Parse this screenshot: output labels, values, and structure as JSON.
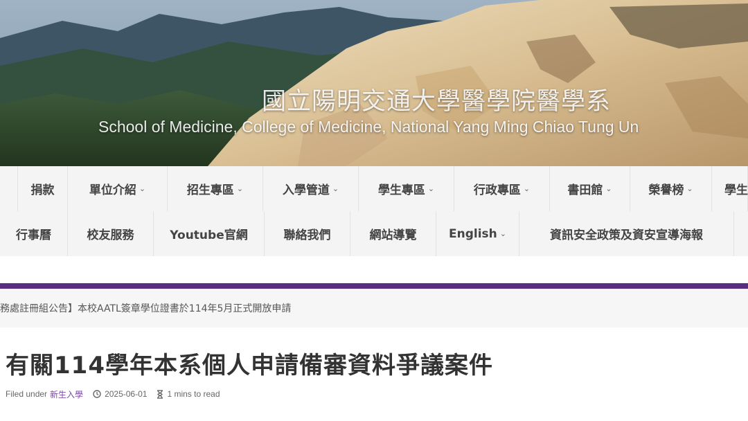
{
  "banner": {
    "title": "國立陽明交通大學醫學院醫學系",
    "subtitle": "School of Medicine, College of Medicine, National Yang Ming Chiao Tung Un"
  },
  "nav": {
    "row1": [
      {
        "label": "捐款",
        "dropdown": false
      },
      {
        "label": "單位介紹",
        "dropdown": true
      },
      {
        "label": "招生專區",
        "dropdown": true
      },
      {
        "label": "入學管道",
        "dropdown": true
      },
      {
        "label": "學生專區",
        "dropdown": true
      },
      {
        "label": "行政專區",
        "dropdown": true
      },
      {
        "label": "書田館",
        "dropdown": true
      },
      {
        "label": "榮譽榜",
        "dropdown": true
      },
      {
        "label": "學生",
        "dropdown": false
      }
    ],
    "row2": [
      {
        "label": "行事曆",
        "dropdown": false
      },
      {
        "label": "校友服務",
        "dropdown": false
      },
      {
        "label": "Youtube官網",
        "dropdown": false
      },
      {
        "label": "聯絡我們",
        "dropdown": false
      },
      {
        "label": "網站導覽",
        "dropdown": false
      },
      {
        "label": "English",
        "dropdown": true
      },
      {
        "label": "資訊安全政策及資安宣導海報",
        "dropdown": false
      }
    ]
  },
  "ticker": {
    "text": "務處註冊組公告】本校AATL簽章學位證書於114年5月正式開放申請"
  },
  "article": {
    "title": "有關114學年本系個人申請備審資料爭議案件",
    "filed_under_label": "Filed under",
    "category": "新生入學",
    "date": "2025-06-01",
    "read_time": "1 mins to read"
  },
  "colors": {
    "accent_purple": "#5c2d7e",
    "nav_background": "#f4f4f4"
  },
  "icons": [
    "chevron-down-icon",
    "clock-icon",
    "hourglass-icon"
  ]
}
